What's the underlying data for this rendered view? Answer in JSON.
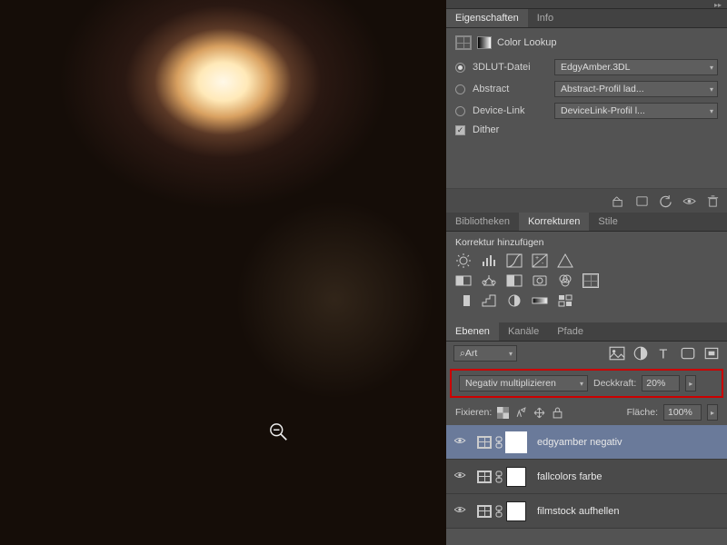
{
  "properties": {
    "tabs": [
      "Eigenschaften",
      "Info"
    ],
    "active_tab": 0,
    "title": "Color Lookup",
    "options": {
      "lut": {
        "label": "3DLUT-Datei",
        "value": "EdgyAmber.3DL",
        "checked": true
      },
      "abstract": {
        "label": "Abstract",
        "value": "Abstract-Profil lad...",
        "checked": false
      },
      "device": {
        "label": "Device-Link",
        "value": "DeviceLink-Profil l...",
        "checked": false
      }
    },
    "dither": {
      "label": "Dither",
      "checked": true
    }
  },
  "adjustments": {
    "tabs": [
      "Bibliotheken",
      "Korrekturen",
      "Stile"
    ],
    "active_tab": 1,
    "title": "Korrektur hinzufügen"
  },
  "layers": {
    "tabs": [
      "Ebenen",
      "Kanäle",
      "Pfade"
    ],
    "active_tab": 0,
    "kind_prefix": " ",
    "kind_value": "Art",
    "blend_mode": "Negativ multiplizieren",
    "opacity_label": "Deckkraft:",
    "opacity_value": "20%",
    "lock_label": "Fixieren:",
    "fill_label": "Fläche:",
    "fill_value": "100%",
    "items": [
      {
        "name": "edgyamber negativ",
        "selected": true,
        "visible": true
      },
      {
        "name": "fallcolors farbe",
        "selected": false,
        "visible": true
      },
      {
        "name": "filmstock aufhellen",
        "selected": false,
        "visible": true
      }
    ]
  },
  "search_icon": "⌕"
}
